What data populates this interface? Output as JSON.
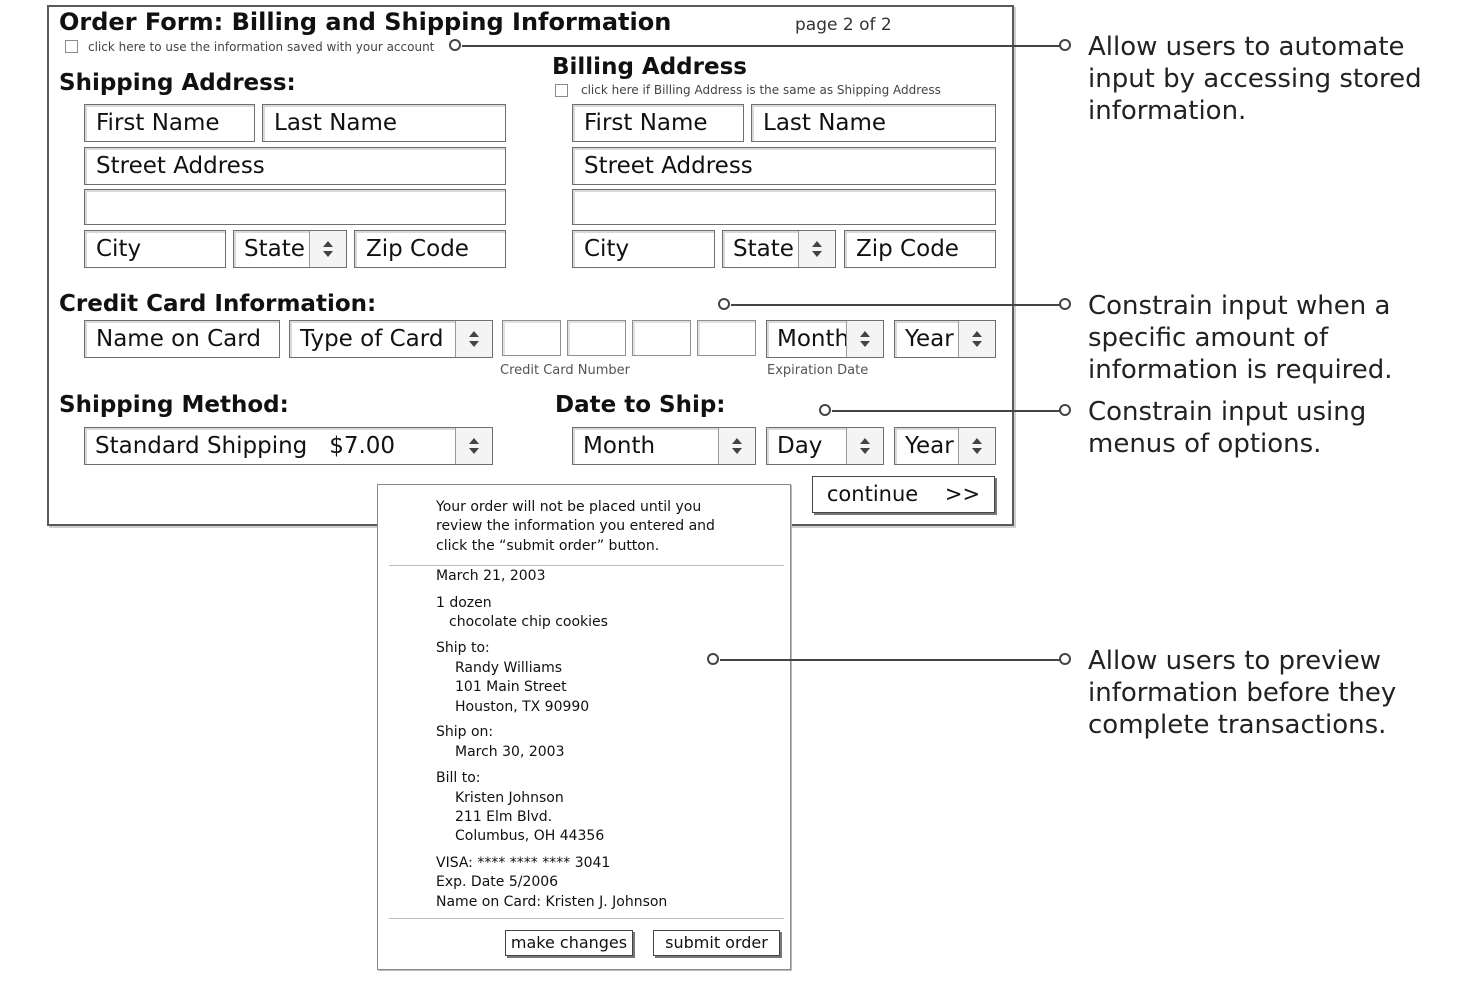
{
  "form": {
    "title": "Order Form: Billing and Shipping Information",
    "page_indicator": "page 2 of 2",
    "saved_info_checkbox_label": "click here to use the information saved with your account",
    "shipping": {
      "heading": "Shipping Address:",
      "first_name": "First Name",
      "last_name": "Last Name",
      "street": "Street Address",
      "street2": "",
      "city": "City",
      "state": "State",
      "zip": "Zip Code"
    },
    "billing": {
      "heading": "Billing Address",
      "same_as_checkbox_label": "click here if Billing Address is the same as Shipping Address",
      "first_name": "First Name",
      "last_name": "Last Name",
      "street": "Street Address",
      "street2": "",
      "city": "City",
      "state": "State",
      "zip": "Zip Code"
    },
    "credit_card": {
      "heading": "Credit Card Information:",
      "name_on_card": "Name on Card",
      "type_of_card": "Type of Card",
      "number_caption": "Credit Card Number",
      "exp_month": "Month",
      "exp_year": "Year",
      "expiration_caption": "Expiration Date"
    },
    "shipping_method": {
      "heading": "Shipping Method:",
      "selected": "Standard Shipping   $7.00"
    },
    "date_to_ship": {
      "heading": "Date to Ship:",
      "month": "Month",
      "day": "Day",
      "year": "Year"
    },
    "continue_label": "continue    >>"
  },
  "preview": {
    "intro_1": "Your order will not be placed until you",
    "intro_2": "review the information you entered and",
    "intro_3": "click the “submit order” button.",
    "date": "March 21, 2003",
    "quantity": "1 dozen",
    "item": "chocolate chip cookies",
    "ship_to_label": "Ship to:",
    "ship_to_name": "Randy Williams",
    "ship_to_street": "101 Main Street",
    "ship_to_city": "Houston, TX 90990",
    "ship_on_label": "Ship on:",
    "ship_on_date": "March 30, 2003",
    "bill_to_label": "Bill to:",
    "bill_to_name": "Kristen Johnson",
    "bill_to_street": "211 Elm Blvd.",
    "bill_to_city": "Columbus, OH 44356",
    "card": "VISA: **** **** **** 3041",
    "exp": "Exp. Date 5/2006",
    "name_on_card": "Name on Card: Kristen J. Johnson",
    "make_changes_label": "make changes",
    "submit_order_label": "submit order"
  },
  "callouts": [
    {
      "text": "Allow users to automate\ninput by accessing stored\ninformation."
    },
    {
      "text": "Constrain input when a\nspecific amount of\ninformation is required."
    },
    {
      "text": "Constrain input using\nmenus of options."
    },
    {
      "text": "Allow users to preview\ninformation before they\ncomplete transactions."
    }
  ],
  "icons": {
    "select_arrow": "up-down-arrows-icon",
    "callout_marker": "circle-icon"
  },
  "colors": {
    "border": "#5a5a5a",
    "text": "#111111",
    "callout_line": "#444444"
  }
}
